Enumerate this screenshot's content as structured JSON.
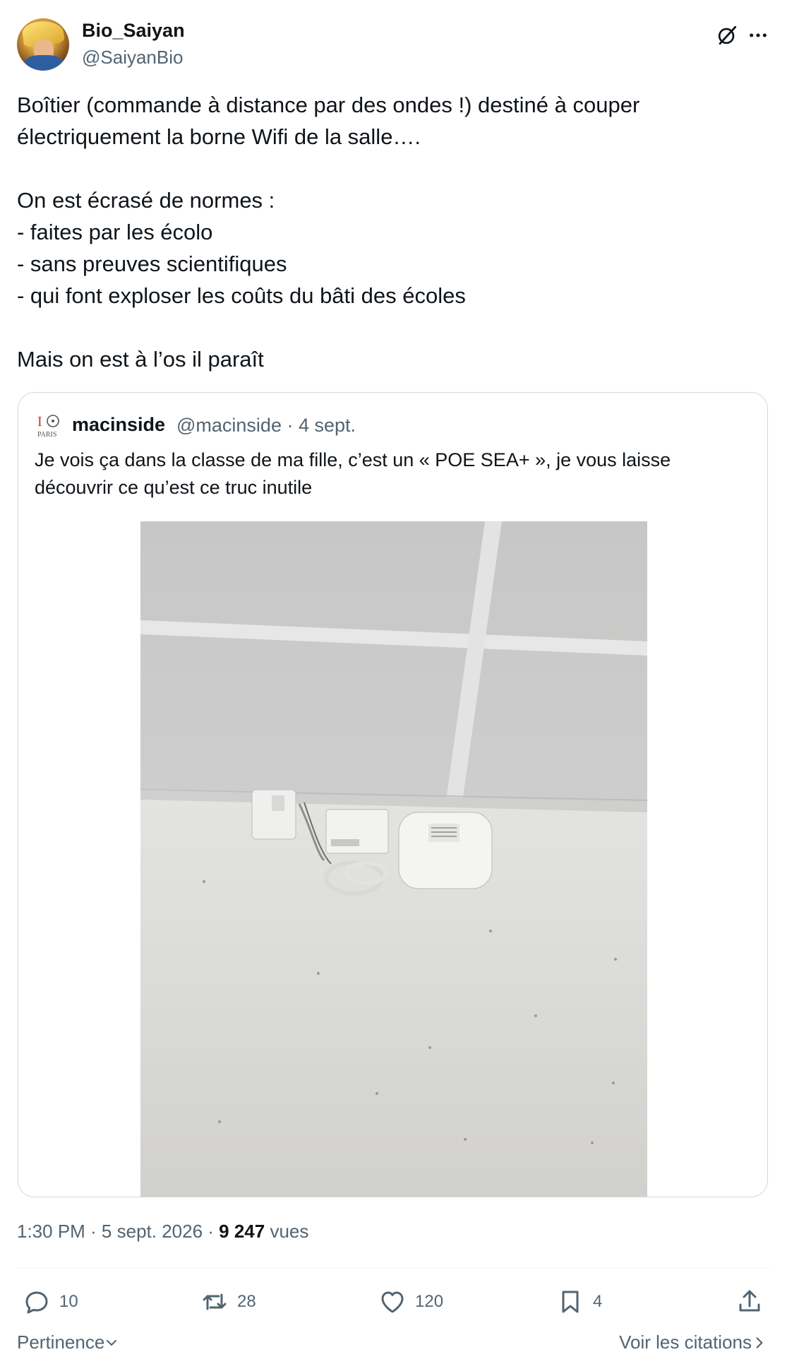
{
  "author": {
    "display_name": "Bio_Saiyan",
    "handle": "@SaiyanBio"
  },
  "header_icons": [
    "grok-icon",
    "more-icon"
  ],
  "tweet": {
    "text": "Boîtier (commande à distance par des ondes !) destiné à couper\nélectriquement la borne Wifi de la salle….\n\nOn est écrasé de normes :\n- faites par les écolo\n- sans preuves scientifiques\n- qui font exploser les coûts du bâti des écoles\n\nMais on est à l’os il paraît"
  },
  "quote": {
    "logo_text": "IO PARIS",
    "name": "macinside",
    "meta": "@macinside · 4 sept.",
    "text": "Je vois ça dans la classe de ma fille, c’est un « POE SEA+ », je vous laisse\ndécouvrir ce qu’est ce truc inutile"
  },
  "timestamp": {
    "time_date": "1:30 PM · 5 sept. 2026 · ",
    "views_count": "9 247",
    "views_label": " vues"
  },
  "actions": {
    "replies": "10",
    "reposts": "28",
    "likes": "120",
    "bookmarks": "4"
  },
  "footer": {
    "sort_label": "Pertinence",
    "quotes_link": "Voir les citations"
  },
  "colors": {
    "text": "#0f1419",
    "secondary": "#536471",
    "border": "#cfd9de"
  }
}
